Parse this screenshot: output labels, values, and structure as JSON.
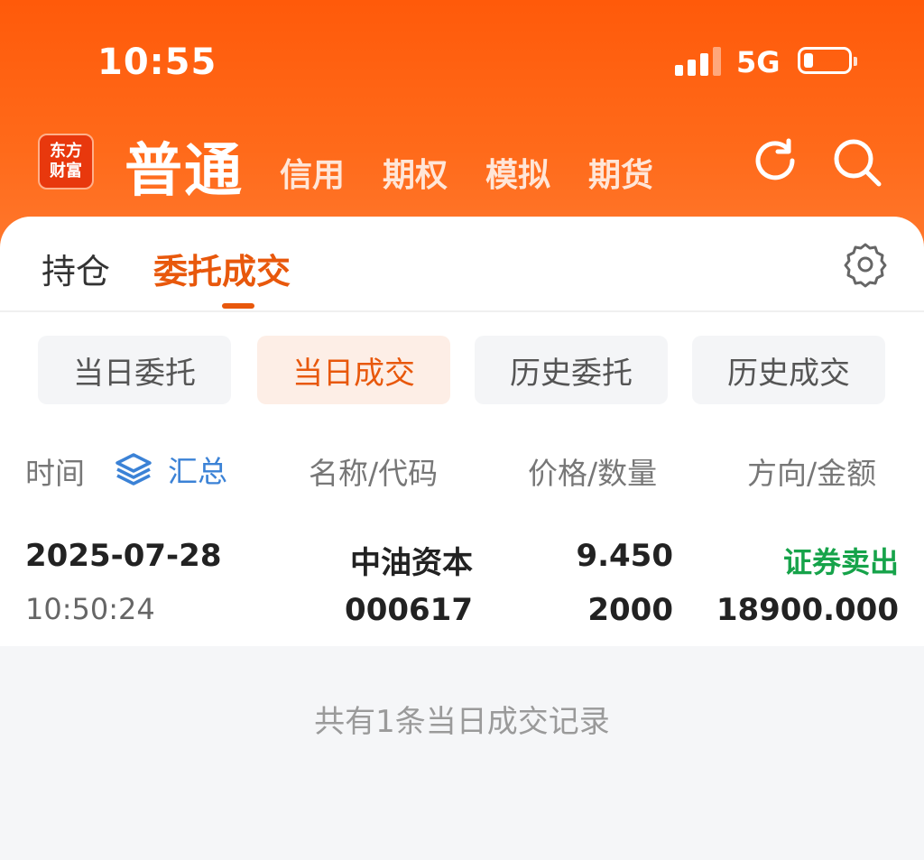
{
  "status_bar": {
    "time": "10:55",
    "network": "5G",
    "signal_bars": 3,
    "battery_level": 0.2
  },
  "header": {
    "logo_line1": "东方",
    "logo_line2": "财富",
    "account_active": "普通",
    "account_tabs": [
      "信用",
      "期权",
      "模拟",
      "期货"
    ],
    "icons": [
      "refresh-icon",
      "search-icon"
    ]
  },
  "main_tabs": {
    "items": [
      "持仓",
      "委托成交"
    ],
    "active_index": 1
  },
  "sub_tabs": {
    "items": [
      "当日委托",
      "当日成交",
      "历史委托",
      "历史成交"
    ],
    "active_index": 1
  },
  "columns": {
    "time": "时间",
    "summary": "汇总",
    "name_code": "名称/代码",
    "price_qty": "价格/数量",
    "direction_amount": "方向/金额"
  },
  "trades": [
    {
      "date": "2025-07-28",
      "time": "10:50:24",
      "name": "中油资本",
      "code": "000617",
      "price": "9.450",
      "quantity": "2000",
      "direction": "证券卖出",
      "amount": "18900.000"
    }
  ],
  "footer_note": "共有1条当日成交记录",
  "colors": {
    "brand": "#ff5a0a",
    "accent": "#e8580c",
    "sell_green": "#16a34a",
    "link_blue": "#3b82d6"
  }
}
